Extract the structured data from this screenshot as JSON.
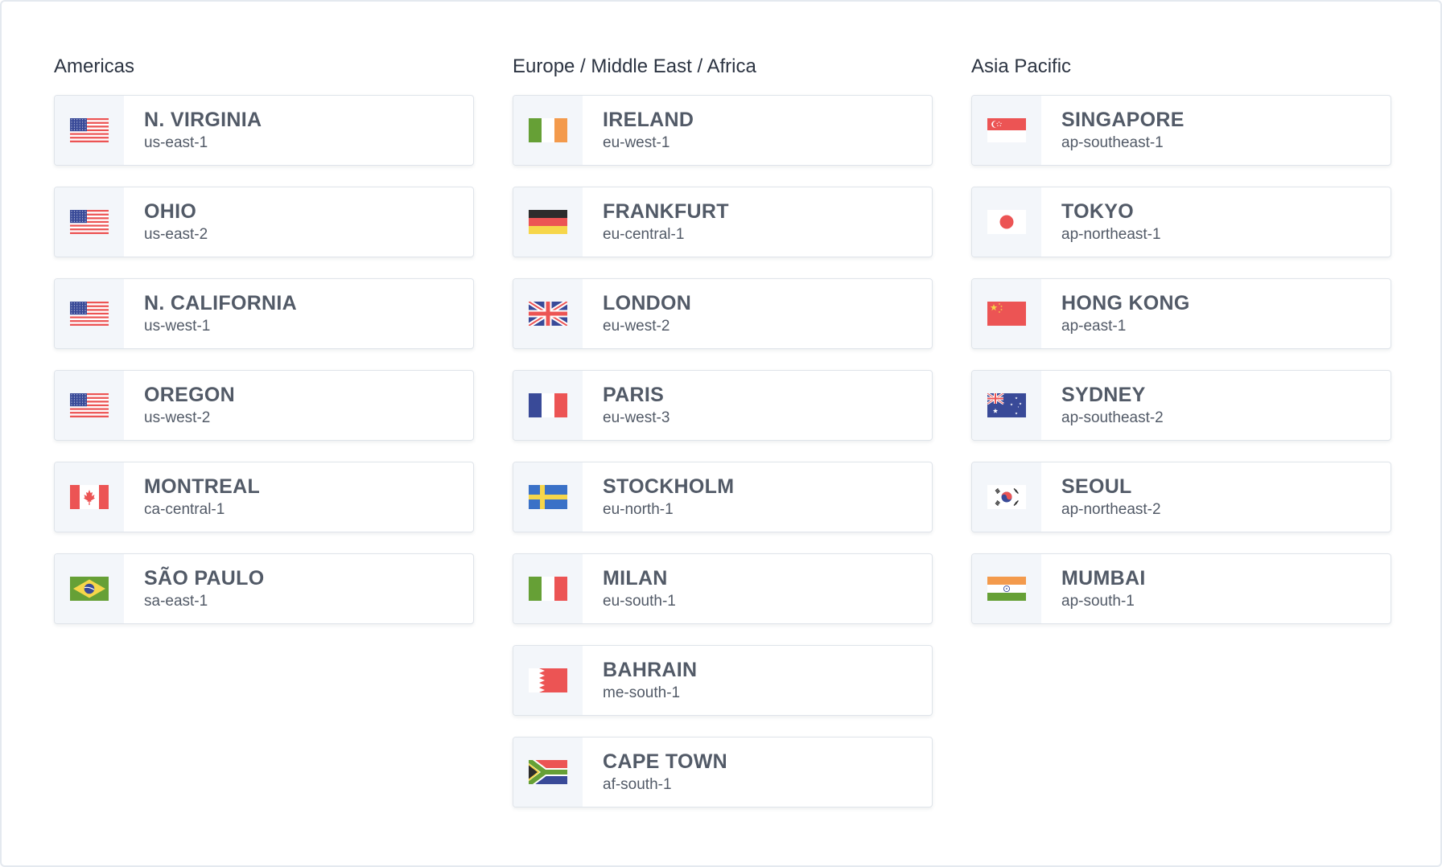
{
  "regions": [
    {
      "title": "Americas",
      "items": [
        {
          "name": "N. VIRGINIA",
          "code": "us-east-1",
          "flag": "us"
        },
        {
          "name": "OHIO",
          "code": "us-east-2",
          "flag": "us"
        },
        {
          "name": "N. CALIFORNIA",
          "code": "us-west-1",
          "flag": "us"
        },
        {
          "name": "OREGON",
          "code": "us-west-2",
          "flag": "us"
        },
        {
          "name": "MONTREAL",
          "code": "ca-central-1",
          "flag": "ca"
        },
        {
          "name": "SÃO PAULO",
          "code": "sa-east-1",
          "flag": "br"
        }
      ]
    },
    {
      "title": "Europe / Middle East / Africa",
      "items": [
        {
          "name": "IRELAND",
          "code": "eu-west-1",
          "flag": "ie"
        },
        {
          "name": "FRANKFURT",
          "code": "eu-central-1",
          "flag": "de"
        },
        {
          "name": "LONDON",
          "code": "eu-west-2",
          "flag": "gb"
        },
        {
          "name": "PARIS",
          "code": "eu-west-3",
          "flag": "fr"
        },
        {
          "name": "STOCKHOLM",
          "code": "eu-north-1",
          "flag": "se"
        },
        {
          "name": "MILAN",
          "code": "eu-south-1",
          "flag": "it"
        },
        {
          "name": "BAHRAIN",
          "code": "me-south-1",
          "flag": "bh"
        },
        {
          "name": "CAPE TOWN",
          "code": "af-south-1",
          "flag": "za"
        }
      ]
    },
    {
      "title": "Asia Pacific",
      "items": [
        {
          "name": "SINGAPORE",
          "code": "ap-southeast-1",
          "flag": "sg"
        },
        {
          "name": "TOKYO",
          "code": "ap-northeast-1",
          "flag": "jp"
        },
        {
          "name": "HONG KONG",
          "code": "ap-east-1",
          "flag": "cn"
        },
        {
          "name": "SYDNEY",
          "code": "ap-southeast-2",
          "flag": "au"
        },
        {
          "name": "SEOUL",
          "code": "ap-northeast-2",
          "flag": "kr"
        },
        {
          "name": "MUMBAI",
          "code": "ap-south-1",
          "flag": "in"
        }
      ]
    }
  ],
  "colors": {
    "flag_red": "#ec5454",
    "flag_blue": "#394a98",
    "flag_green": "#66a036",
    "flag_orange": "#f39a4c",
    "flag_yellow": "#f6d64a",
    "text": "#525a67",
    "title": "#2c3442"
  }
}
